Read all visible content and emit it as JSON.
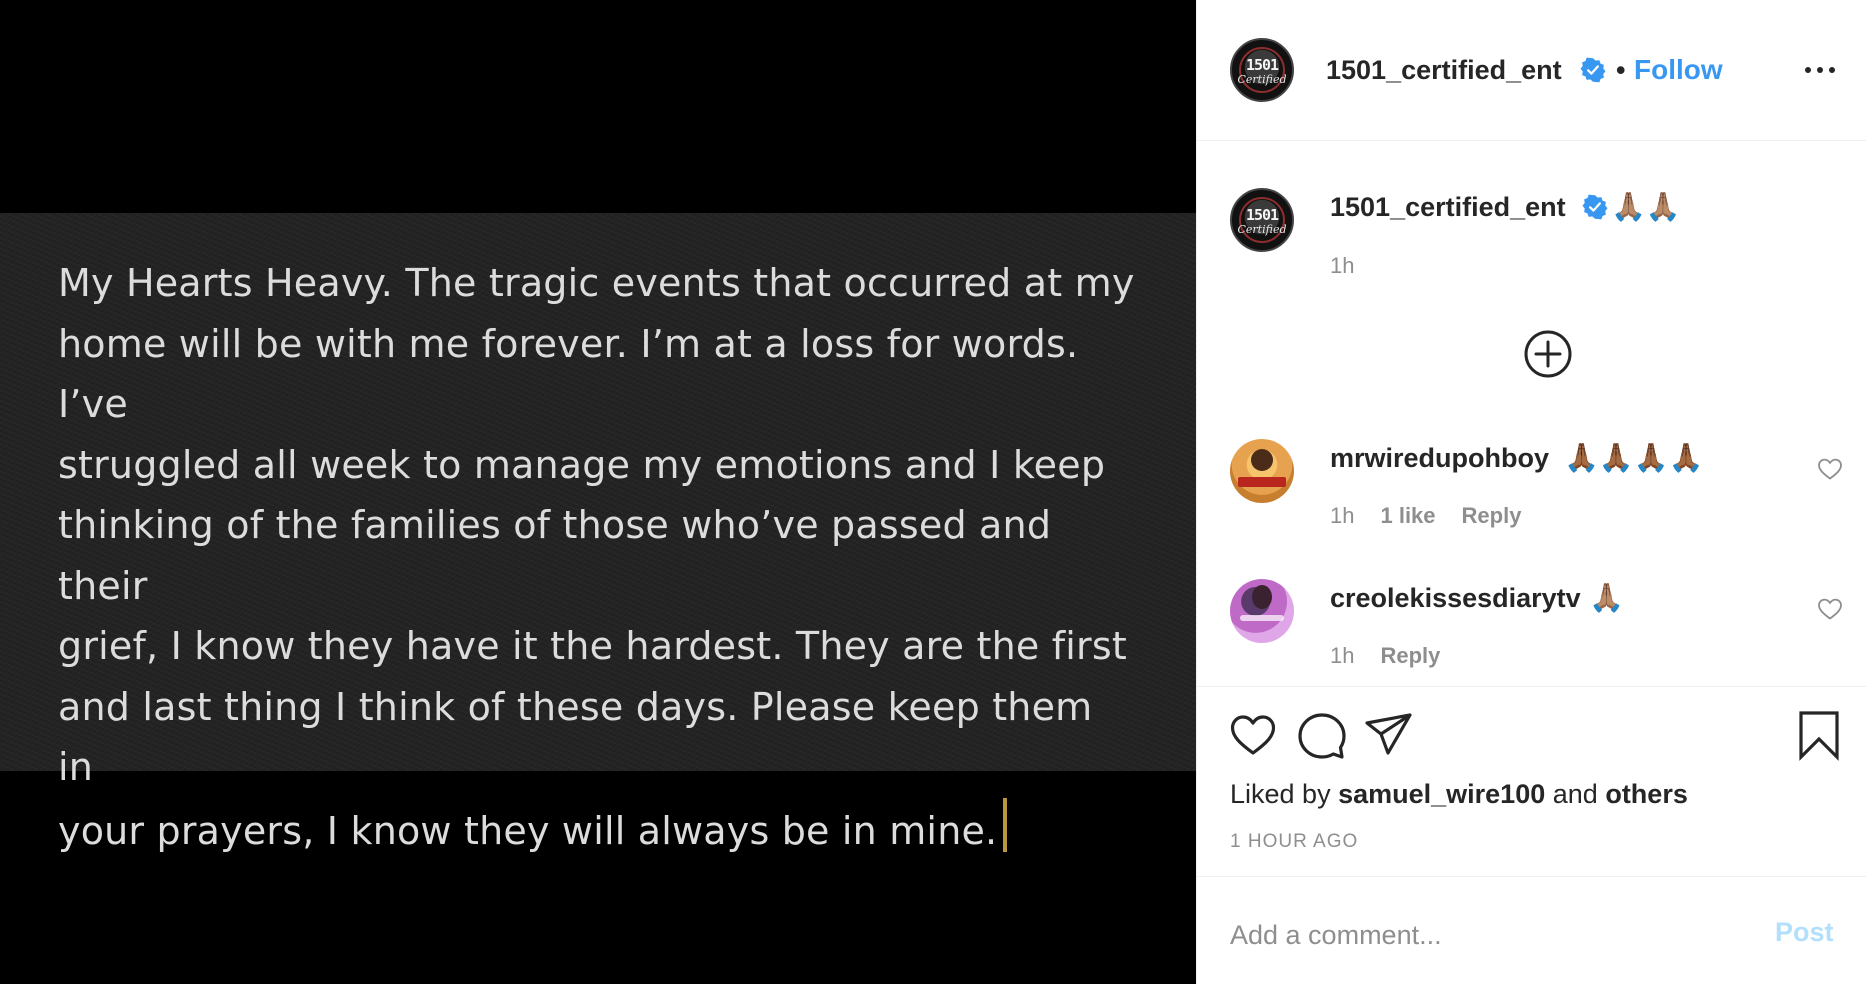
{
  "post": {
    "text_lines": [
      "My Hearts Heavy. The tragic events that occurred at my",
      "home will be with me forever. I’m at a loss for words. I’ve",
      "struggled all week to manage my emotions and I keep",
      "thinking of the families of those who’ve passed and their",
      "grief, I know they have it the hardest. They are the first",
      "and last thing I think of these days. Please keep them in",
      "your prayers, I know they will always be in mine."
    ],
    "cursor_color": "#b8973e"
  },
  "header": {
    "username": "1501_certified_ent",
    "separator": "•",
    "follow_label": "Follow",
    "avatar_logo_top": "1501",
    "avatar_logo_bottom": "Certified",
    "more_icon": "more-horizontal-icon"
  },
  "caption": {
    "username": "1501_certified_ent",
    "text": "🙏🏽🙏🏽",
    "time": "1h"
  },
  "load_more_icon": "plus-circle-icon",
  "comments": [
    {
      "username": "mrwiredupohboy",
      "text": "🙏🏾🙏🏾🙏🏾🙏🏾",
      "time": "1h",
      "likes": "1 like",
      "reply": "Reply"
    },
    {
      "username": "creolekissesdiarytv",
      "text": "🙏🏽",
      "time": "1h",
      "reply": "Reply"
    }
  ],
  "actions": {
    "like_icon": "heart-icon",
    "comment_icon": "comment-icon",
    "share_icon": "paper-plane-icon",
    "save_icon": "bookmark-icon"
  },
  "likes": {
    "prefix": "Liked by",
    "user": "samuel_wire100",
    "conj": "and",
    "others": "others"
  },
  "posted": "1 HOUR AGO",
  "add_comment": {
    "placeholder": "Add a comment...",
    "post_label": "Post"
  },
  "colors": {
    "accent": "#3897f0",
    "post_disabled": "#b2dffc",
    "secondary_text": "#8e8e8e",
    "media_bg": "#000000",
    "card_bg": "#232323"
  }
}
